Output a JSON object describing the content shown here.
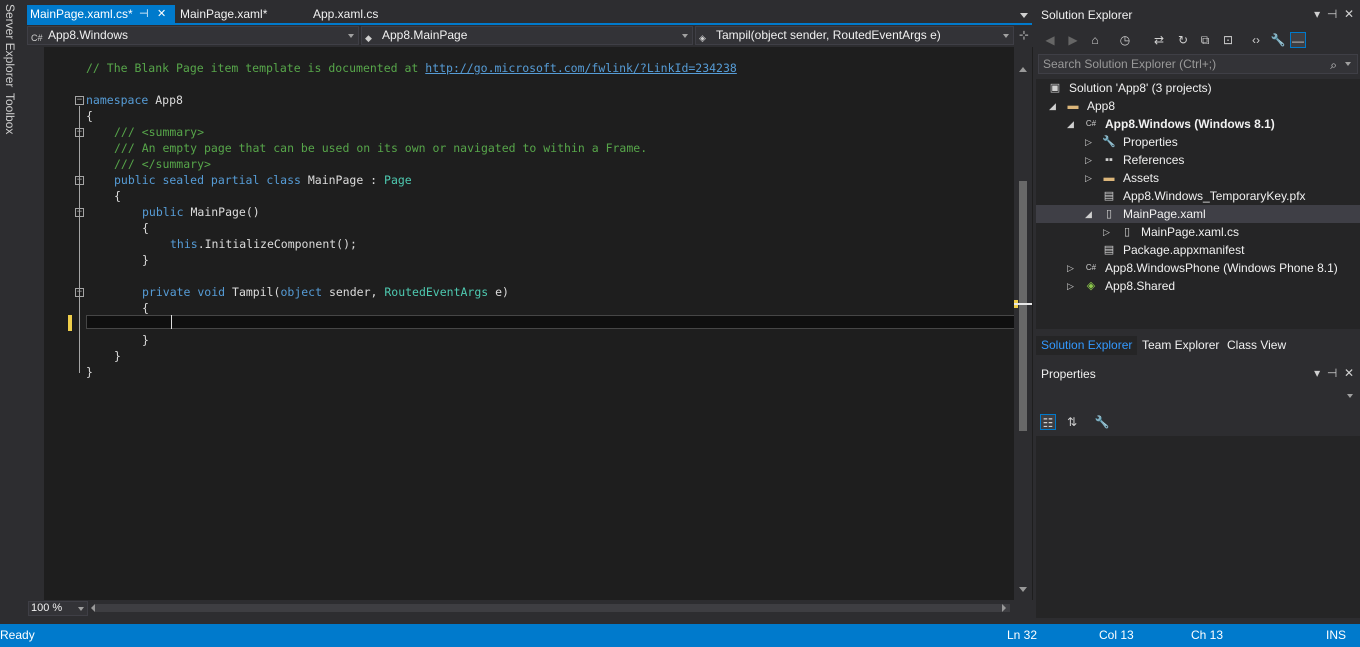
{
  "side_tabs": [
    "Server Explorer",
    "Toolbox"
  ],
  "tabs": [
    {
      "label": "MainPage.xaml.cs*",
      "active": true
    },
    {
      "label": "MainPage.xaml*",
      "active": false
    },
    {
      "label": "App.xaml.cs",
      "active": false
    }
  ],
  "nav": {
    "project": "App8.Windows",
    "type": "App8.MainPage",
    "member": "Tampil(object sender, RoutedEventArgs e)"
  },
  "code": {
    "comment_prefix": "// The Blank Page item template is documented at ",
    "comment_link": "http://go.microsoft.com/fwlink/?LinkId=234238",
    "ns_kw": "namespace",
    "ns_name": " App8",
    "open_ns": "{",
    "sum1": "/// <summary>",
    "sum2": "/// An empty page that can be used on its own or navigated to within a Frame.",
    "sum3": "/// </summary>",
    "class_kw": "public sealed partial class",
    "class_name": " MainPage : ",
    "class_base": "Page",
    "open_cls": "{",
    "ctor_kw": "public",
    "ctor_name": " MainPage()",
    "open_ctor": "{",
    "this_kw": "this",
    "init_call": ".InitializeComponent();",
    "close_ctor": "}",
    "m_kw": "private void",
    "m_name": " Tampil(",
    "m_obj": "object",
    "m_sender": " sender, ",
    "m_type": "RoutedEventArgs",
    "m_e": " e)",
    "open_m": "{",
    "close_m": "}",
    "close_cls": "}",
    "close_ns": "}"
  },
  "zoom": "100 %",
  "solution_explorer": {
    "title": "Solution Explorer",
    "search_placeholder": "Search Solution Explorer (Ctrl+;)",
    "nodes": [
      {
        "label": "Solution 'App8' (3 projects)"
      },
      {
        "label": "App8"
      },
      {
        "label": "App8.Windows (Windows 8.1)"
      },
      {
        "label": "Properties"
      },
      {
        "label": "References"
      },
      {
        "label": "Assets"
      },
      {
        "label": "App8.Windows_TemporaryKey.pfx"
      },
      {
        "label": "MainPage.xaml"
      },
      {
        "label": "MainPage.xaml.cs"
      },
      {
        "label": "Package.appxmanifest"
      },
      {
        "label": "App8.WindowsPhone (Windows Phone 8.1)"
      },
      {
        "label": "App8.Shared"
      }
    ],
    "tabs": [
      "Solution Explorer",
      "Team Explorer",
      "Class View"
    ]
  },
  "properties": {
    "title": "Properties"
  },
  "status": {
    "state": "Ready",
    "line": "Ln 32",
    "col": "Col 13",
    "ch": "Ch 13",
    "mode": "INS"
  }
}
